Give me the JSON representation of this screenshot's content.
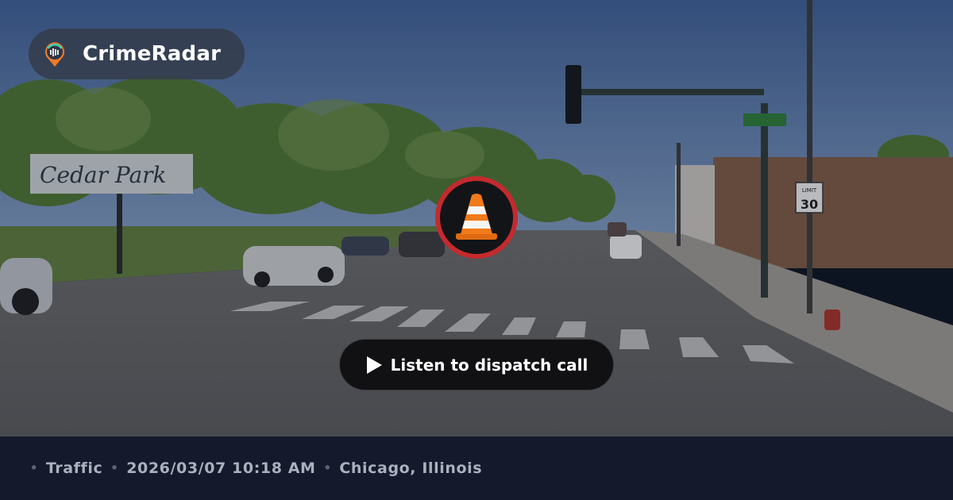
{
  "brand": {
    "name": "CrimeRadar",
    "logo_icon": "radar-pin-icon"
  },
  "incident": {
    "category_icon": "traffic-cone-icon"
  },
  "actions": {
    "listen_label": "Listen to dispatch call",
    "listen_icon": "play-icon"
  },
  "footer": {
    "separator": "•",
    "category": "Traffic",
    "datetime": "2026/03/07 10:18 AM",
    "location": "Chicago, Illinois"
  },
  "scene": {
    "park_sign_text": "Cedar Park",
    "speed_sign_label": "LIMIT",
    "speed_sign_value": "30"
  },
  "colors": {
    "accent_ring": "#c42a2e",
    "cone_orange": "#f07a1a",
    "logo_orange": "#f07a2a",
    "logo_teal": "#3fd0b0",
    "footer_bg": "#141a2c"
  }
}
